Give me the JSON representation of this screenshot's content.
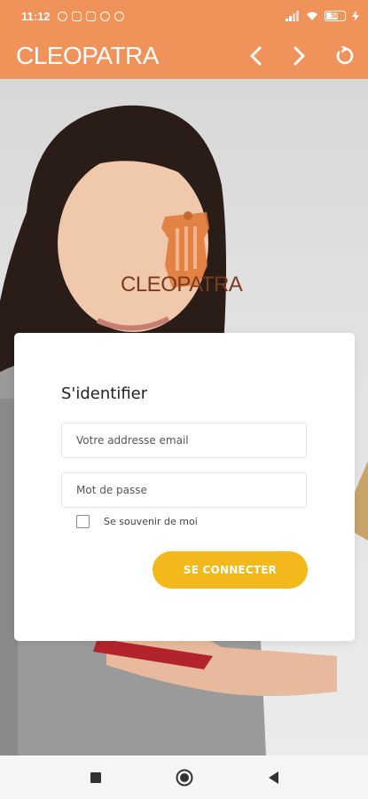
{
  "status_bar": {
    "time": "11:12",
    "battery": "58",
    "icons": [
      "alarm-icon",
      "news-icon",
      "youtube-icon",
      "whatsapp-icon",
      "no-sim-icon",
      "signal-icon",
      "wifi-icon",
      "battery-icon",
      "charging-icon"
    ]
  },
  "toolbar": {
    "title": "CLEOPATRA",
    "back_icon": "chevron-left-icon",
    "forward_icon": "chevron-right-icon",
    "reload_icon": "refresh-icon"
  },
  "brand": {
    "name": "CLEOPATRA",
    "colors": {
      "logo": "#e07a3a",
      "name": "#7b3a1f"
    }
  },
  "login": {
    "title": "S'identifier",
    "email_placeholder": "Votre addresse email",
    "password_placeholder": "Mot de passe",
    "remember_label": "Se souvenir de moi",
    "remember_checked": false,
    "submit_label": "SE CONNECTER"
  },
  "nav_bar": {
    "items": [
      "recents-icon",
      "home-icon",
      "back-icon"
    ]
  },
  "colors": {
    "header": "#f0935a",
    "button": "#f2b81c",
    "card": "#ffffff"
  }
}
